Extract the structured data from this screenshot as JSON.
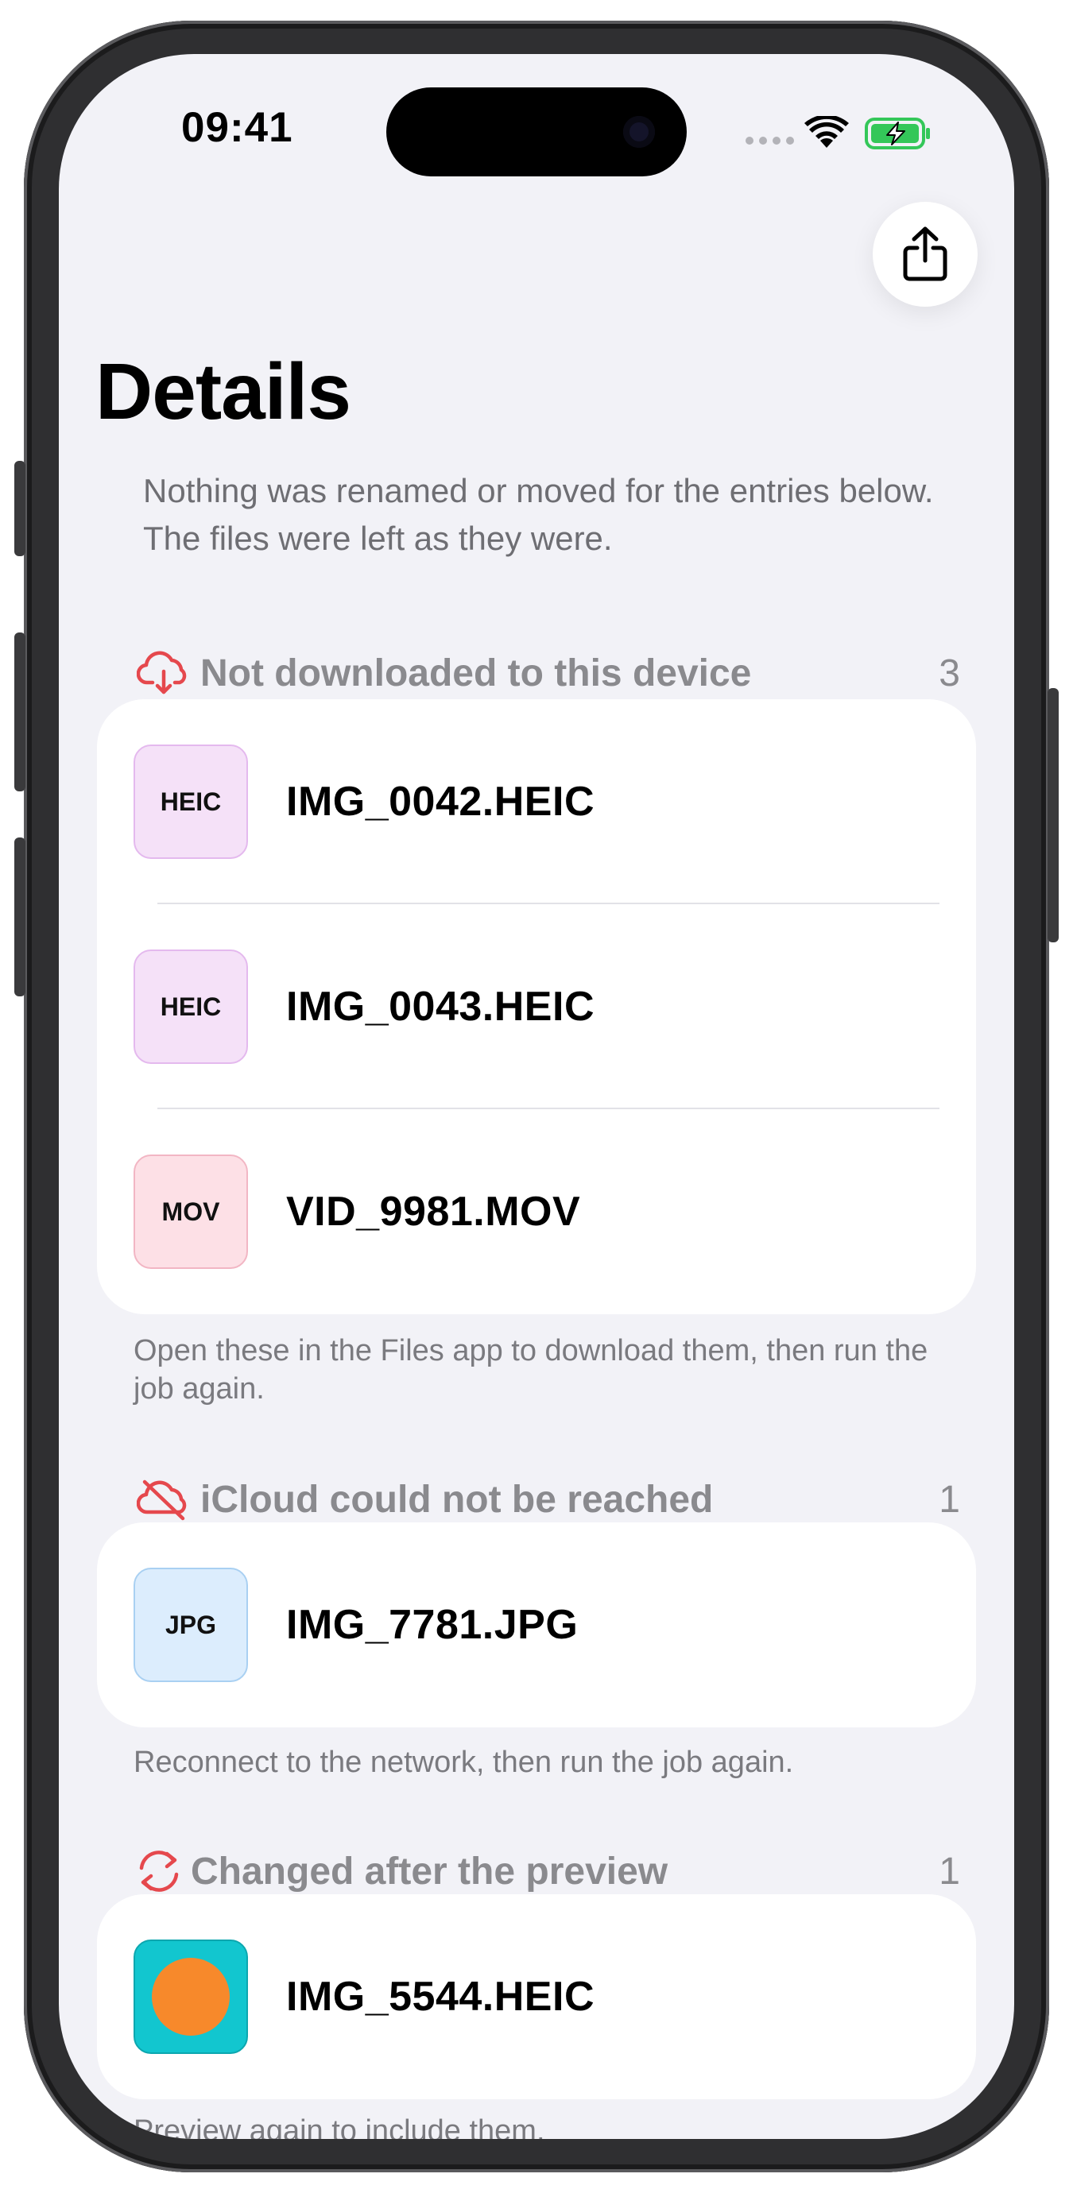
{
  "status_bar": {
    "time": "09:41"
  },
  "header": {
    "title": "Details",
    "share_icon": "share-icon",
    "intro": "Nothing was renamed or moved for the entries below. The files were left as they were."
  },
  "colors": {
    "accent_red": "#e5484d",
    "background": "#f2f2f7",
    "battery_green": "#34c759"
  },
  "sections": [
    {
      "icon": "cloud-download-icon",
      "label": "Not downloaded to this device",
      "count": "3",
      "files": [
        {
          "badge": "HEIC",
          "name": "IMG_0042.HEIC"
        },
        {
          "badge": "HEIC",
          "name": "IMG_0043.HEIC"
        },
        {
          "badge": "MOV",
          "name": "VID_9981.MOV"
        }
      ],
      "footnote": "Open these in the Files app to download them, then run the job again."
    },
    {
      "icon": "cloud-slash-icon",
      "label": "iCloud could not be reached",
      "count": "1",
      "files": [
        {
          "badge": "JPG",
          "name": "IMG_7781.JPG"
        }
      ],
      "footnote": "Reconnect to the network, then run the job again."
    },
    {
      "icon": "sync-arrows-icon",
      "label": "Changed after the preview",
      "count": "1",
      "files": [
        {
          "badge": "",
          "name": "IMG_5544.HEIC"
        }
      ],
      "footnote": "Preview again to include them."
    }
  ]
}
